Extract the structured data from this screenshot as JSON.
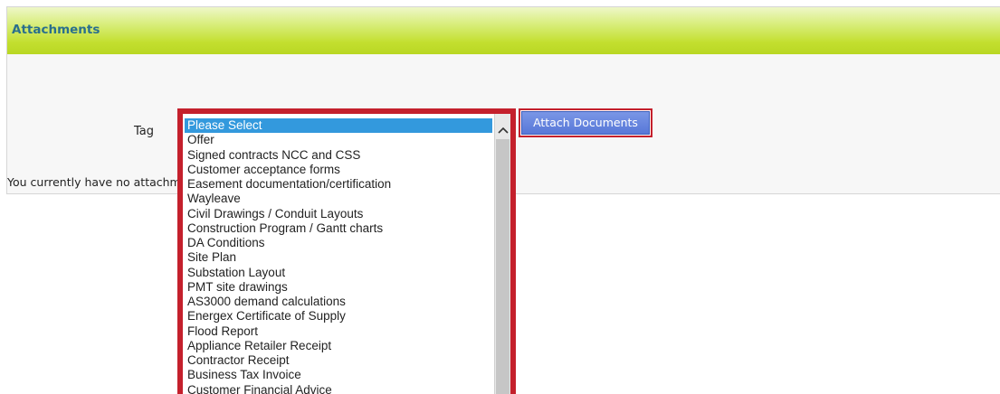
{
  "panel": {
    "title": "Attachments"
  },
  "form": {
    "tag_label": "Tag",
    "no_attachments_text": "You currently have no attachments",
    "attach_button_label": "Attach Documents"
  },
  "tag_select": {
    "selected": "Please Select",
    "options": [
      "Please Select",
      "Offer",
      "Signed contracts NCC and CSS",
      "Customer acceptance forms",
      "Easement documentation/certification",
      "Wayleave",
      "Civil Drawings / Conduit Layouts",
      "Construction Program / Gantt charts",
      "DA Conditions",
      "Site Plan",
      "Substation Layout",
      "PMT site drawings",
      "AS3000 demand calculations",
      "Energex Certificate of Supply",
      "Flood Report",
      "Appliance Retailer Receipt",
      "Contractor Receipt",
      "Business Tax Invoice",
      "Customer Financial Advice"
    ]
  },
  "icons": {
    "scroll_up": "chevron-up-icon"
  },
  "colors": {
    "header_green": "#c3df2f",
    "title_blue": "#2a6f8d",
    "highlight_red": "#c4202c",
    "button_blue": "#5878d8",
    "selected_option": "#3399dd"
  }
}
